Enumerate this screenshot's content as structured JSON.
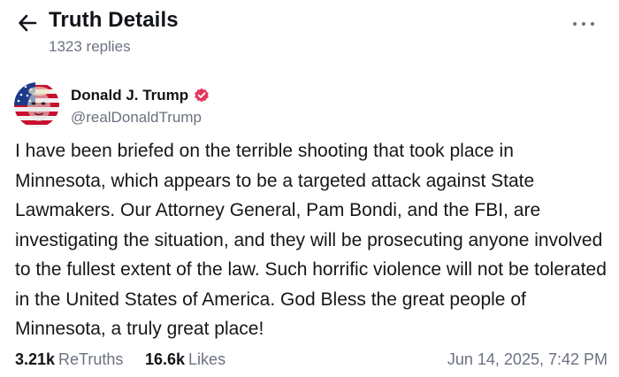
{
  "header": {
    "title": "Truth Details",
    "replies": "1323 replies",
    "back_icon": "arrow-left-icon",
    "more_icon": "more-horizontal-icon"
  },
  "author": {
    "name": "Donald J. Trump",
    "handle": "@realDonaldTrump",
    "verified_color": "#e5375e",
    "avatar": "american-flag-face-avatar"
  },
  "post": {
    "text": "I have been briefed on the terrible shooting that took place in Minnesota, which appears to be a targeted attack against State Lawmakers. Our Attorney General, Pam Bondi, and the FBI, are investigating the situation, and they will be prosecuting anyone involved to the fullest extent of the law. Such horrific violence will not be tolerated in the United States of America. God Bless the great people of Minnesota, a truly great place!"
  },
  "stats": {
    "retruths_count": "3.21k",
    "retruths_label": "ReTruths",
    "likes_count": "16.6k",
    "likes_label": "Likes",
    "timestamp": "Jun 14, 2025, 7:42 PM"
  }
}
